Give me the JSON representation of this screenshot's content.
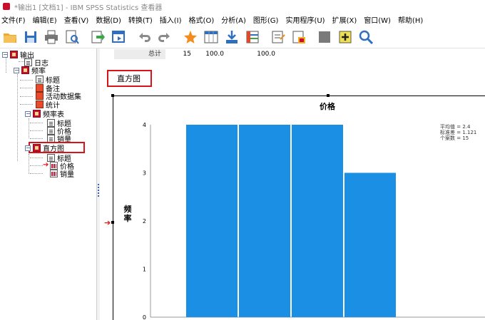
{
  "window": {
    "title": "*输出1 [文档1] - IBM SPSS Statistics 查看器"
  },
  "menu": [
    "文件(F)",
    "编辑(E)",
    "查看(V)",
    "数据(D)",
    "转换(T)",
    "插入(I)",
    "格式(O)",
    "分析(A)",
    "图形(G)",
    "实用程序(U)",
    "扩展(X)",
    "窗口(W)",
    "帮助(H)"
  ],
  "toolbar": {
    "icons": [
      "open-folder-icon",
      "save-icon",
      "print-icon",
      "print-preview-icon",
      "export-icon",
      "recall-dialog-icon",
      "undo-icon",
      "redo-icon",
      "goto-case-icon",
      "goto-variable-icon",
      "variables-icon",
      "data-list-icon",
      "insert-heading-icon",
      "insert-title-icon",
      "hide-icon",
      "promote-icon",
      "search-icon"
    ]
  },
  "nav": {
    "output": "输出",
    "log": "日志",
    "frequencies": "频率",
    "title": "标题",
    "notes": "备注",
    "active_dataset": "活动数据集",
    "statistics": "统计",
    "freq_table": "频率表",
    "ft_title": "标题",
    "ft_price": "价格",
    "ft_sales": "销量",
    "histogram": "直方图",
    "h_title": "标题",
    "h_price": "价格",
    "h_sales": "销量"
  },
  "table_total": {
    "label": "总计",
    "count": "15",
    "percent": "100.0",
    "valid_percent": "100.0"
  },
  "histogram_heading": "直方图",
  "chart_data": {
    "type": "bar",
    "title": "价格",
    "ylabel": "频率",
    "xlabel": "",
    "ylim": [
      0,
      4
    ],
    "yticks": [
      "0",
      "1",
      "2",
      "3",
      "4"
    ],
    "values": [
      4,
      4,
      4,
      3
    ],
    "bar_color": "#1a8fe3",
    "stats": [
      "平均值 = 2.4",
      "标准差 = 1.121",
      "个案数 = 15"
    ]
  }
}
